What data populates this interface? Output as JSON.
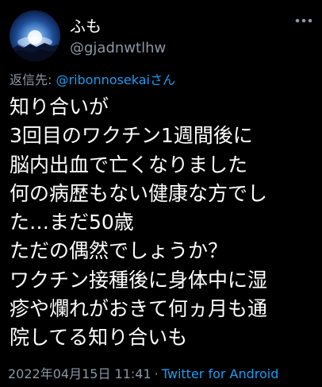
{
  "tweet": {
    "display_name": "ふも",
    "handle": "@gjadnwtlhw",
    "reply_prefix": "返信先: ",
    "reply_to": "@ribonnosekaiさん",
    "body_lines": [
      "知り合いが",
      "3回目のワクチン1週間後に",
      "脳内出血で亡くなりました",
      "何の病歴もない健康な方でし",
      "た…まだ50歳",
      "ただの偶然でしょうか？",
      "ワクチン接種後に身体中に湿",
      "疹や爛れがおきて何ヵ月も通",
      "院してる知り合いも"
    ],
    "timestamp": "2022年04月15日 11:41",
    "separator": "·",
    "source": "Twitter for Android"
  },
  "icons": {
    "avatar": "sky-landscape-avatar",
    "more": "more-dots-icon"
  },
  "colors": {
    "background": "#000000",
    "text": "#ffffff",
    "secondary": "#8b98a5",
    "accent": "#1d9bf0"
  }
}
